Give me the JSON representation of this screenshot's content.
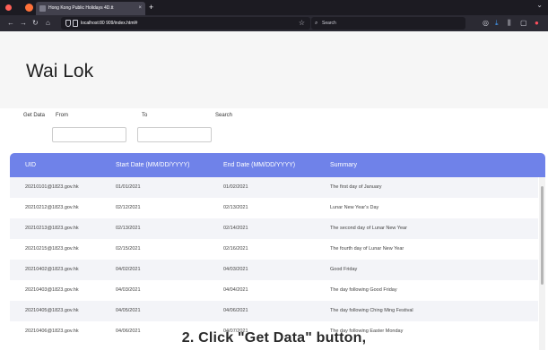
{
  "browser": {
    "tab_title": "Hong Kong Public Holidays 4D.tt",
    "tab_close": "×",
    "new_tab": "+",
    "url": "localhost:80 909/index.html#",
    "search_placeholder": "Search",
    "icons": [
      "back-icon",
      "forward-icon",
      "reload-icon",
      "home-icon",
      "shield-icon",
      "star-icon",
      "search-icon",
      "pocket-icon",
      "download-icon",
      "library-icon",
      "extensions-icon",
      "profile-icon"
    ]
  },
  "app": {
    "title": "Wai Lok"
  },
  "filters": {
    "get_data_label": "Get Data",
    "from_label": "From",
    "to_label": "To",
    "search_label": "Search",
    "from_value": "",
    "to_value": ""
  },
  "table": {
    "headers": [
      "UID",
      "Start Date (MM/DD/YYYY)",
      "End Date (MM/DD/YYYY)",
      "Summary"
    ],
    "rows": [
      [
        "20210101@1823.gov.hk",
        "01/01/2021",
        "01/02/2021",
        "The first day of January"
      ],
      [
        "20210212@1823.gov.hk",
        "02/12/2021",
        "02/13/2021",
        "Lunar New Year's Day"
      ],
      [
        "20210213@1823.gov.hk",
        "02/13/2021",
        "02/14/2021",
        "The second day of Lunar New Year"
      ],
      [
        "20210215@1823.gov.hk",
        "02/15/2021",
        "02/16/2021",
        "The fourth day of Lunar New Year"
      ],
      [
        "20210402@1823.gov.hk",
        "04/02/2021",
        "04/03/2021",
        "Good Friday"
      ],
      [
        "20210403@1823.gov.hk",
        "04/03/2021",
        "04/04/2021",
        "The day following Good Friday"
      ],
      [
        "20210405@1823.gov.hk",
        "04/05/2021",
        "04/06/2021",
        "The day following Ching Ming Festival"
      ],
      [
        "20210406@1823.gov.hk",
        "04/06/2021",
        "04/07/2021",
        "The day following Easter Monday"
      ]
    ]
  },
  "caption": "2. Click \"Get Data\" button,",
  "colors": {
    "header_bg": "#6f82e9",
    "row_alt": "#f3f4f8",
    "browser_dark": "#1c1b22"
  }
}
